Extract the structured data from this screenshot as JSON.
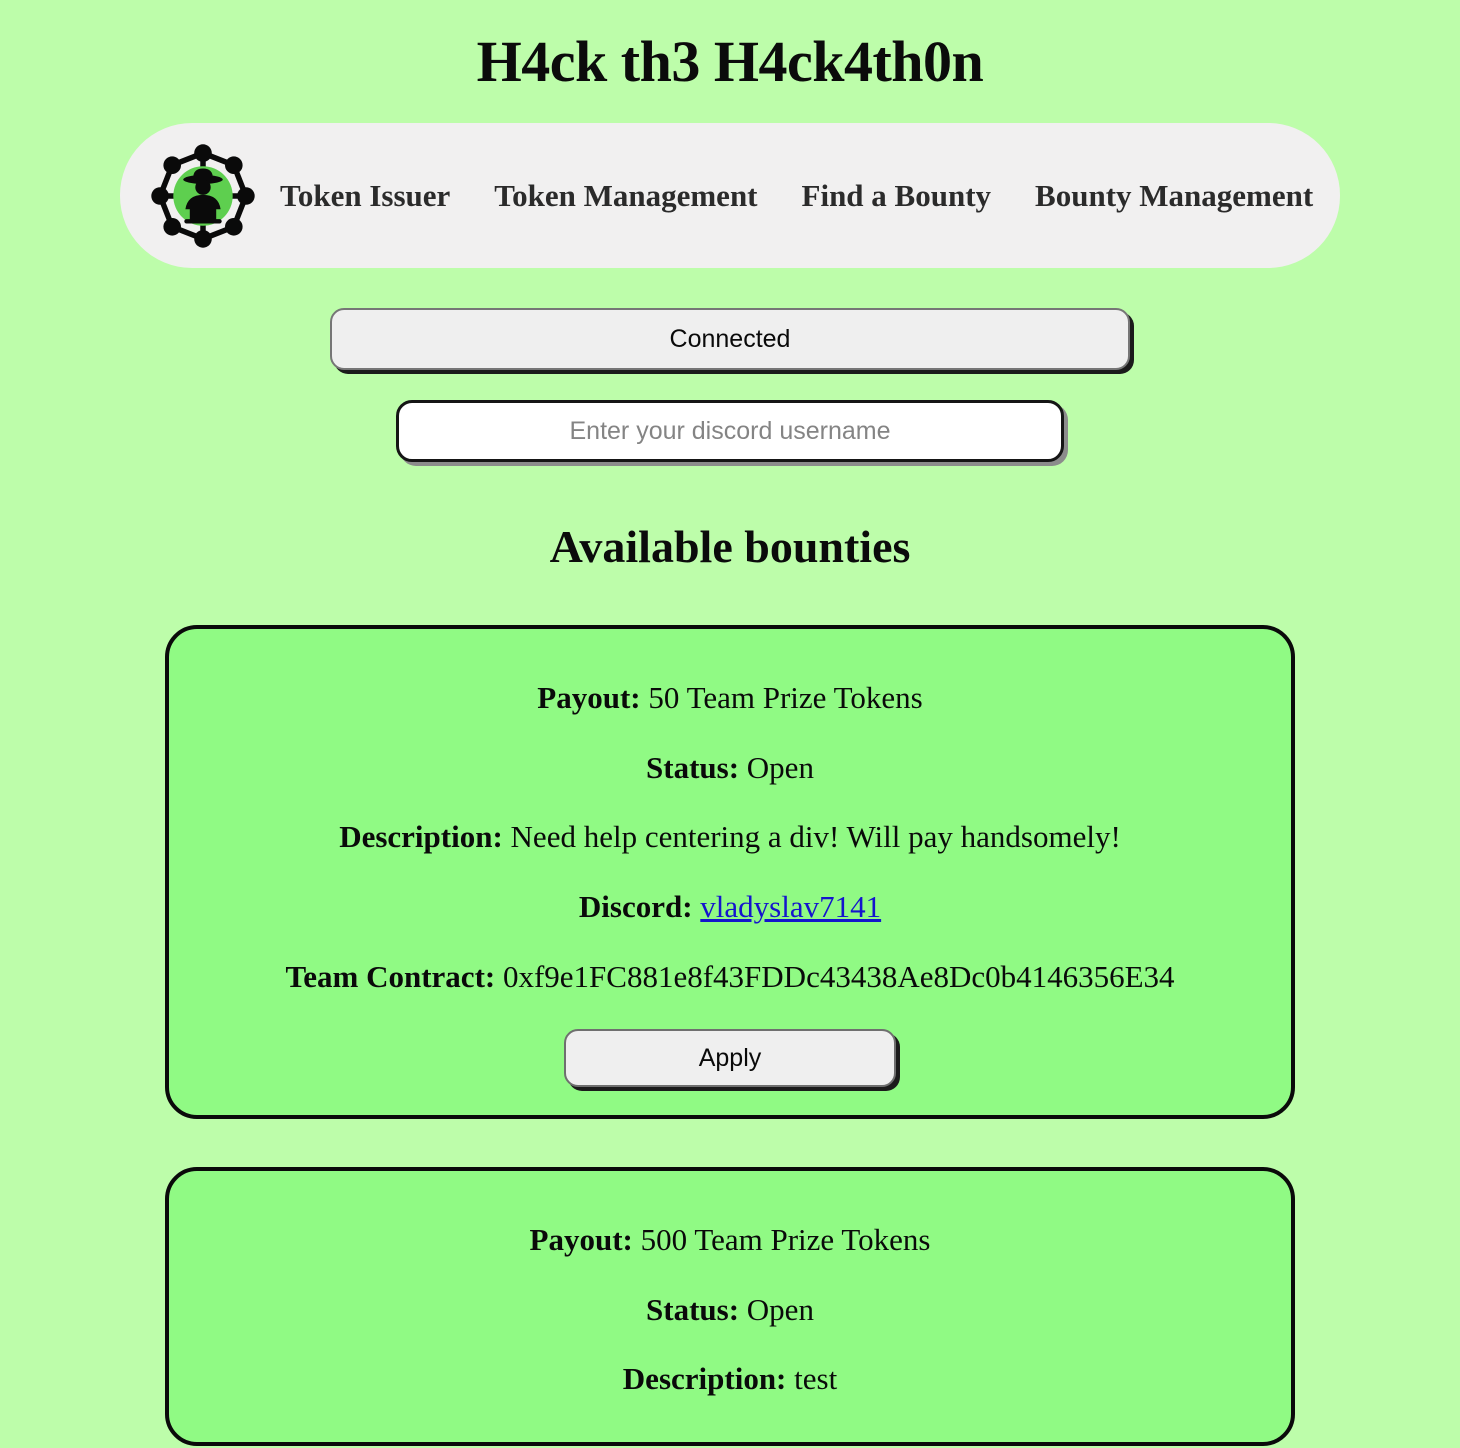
{
  "page": {
    "title": "H4ck th3 H4ck4th0n",
    "background_color": "#bdfdaa"
  },
  "navbar": {
    "logo_icon": "hacker-network-logo-icon",
    "background_color": "#f1f0f0",
    "accent_color": "#5ecf4f",
    "links": [
      {
        "label": "Token Issuer"
      },
      {
        "label": "Token Management"
      },
      {
        "label": "Find a Bounty"
      },
      {
        "label": "Bounty Management"
      }
    ]
  },
  "wallet": {
    "connect_label": "Connected"
  },
  "discord_field": {
    "value": "",
    "placeholder": "Enter your discord username"
  },
  "bounties_section": {
    "heading": "Available bounties",
    "card_color": "#90fa84",
    "labels": {
      "payout": "Payout:",
      "status": "Status:",
      "description": "Description:",
      "discord": "Discord:",
      "team_contract": "Team Contract:"
    },
    "apply_label": "Apply",
    "items": [
      {
        "payout": "50 Team Prize Tokens",
        "status": "Open",
        "description": "Need help centering a div! Will pay handsomely!",
        "discord": "vladyslav7141",
        "team_contract": "0xf9e1FC881e8f43FDDc43438Ae8Dc0b4146356E34",
        "apply_label": "Apply"
      },
      {
        "payout": "500 Team Prize Tokens",
        "status": "Open",
        "description": "test"
      }
    ]
  }
}
